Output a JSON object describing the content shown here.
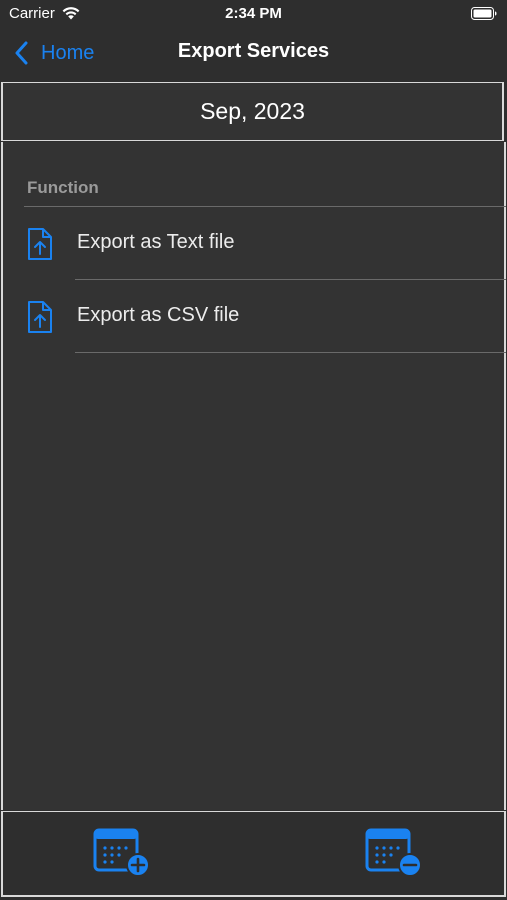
{
  "status_bar": {
    "carrier": "Carrier",
    "time": "2:34 PM"
  },
  "nav": {
    "back_label": "Home",
    "title": "Export Services"
  },
  "date_header": "Sep, 2023",
  "section": {
    "header": "Function",
    "items": [
      {
        "label": "Export as Text file",
        "icon": "file-upload-icon"
      },
      {
        "label": "Export as CSV file",
        "icon": "file-upload-icon"
      }
    ]
  },
  "toolbar": {
    "add_icon": "calendar-add-icon",
    "remove_icon": "calendar-remove-icon"
  },
  "colors": {
    "accent": "#1a82f0",
    "background": "#2e2e2e",
    "text": "#ffffff",
    "section_header": "#9a9a9a"
  }
}
